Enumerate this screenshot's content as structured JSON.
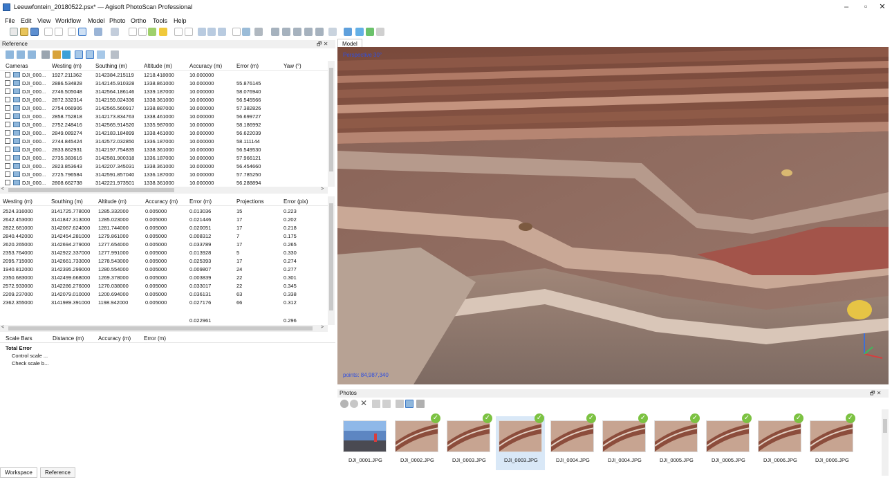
{
  "window": {
    "title": "Leeuwfontein_20180522.psx* — Agisoft PhotoScan Professional",
    "minimize": "–",
    "maximize": "▫",
    "close": "✕"
  },
  "menu": [
    "File",
    "Edit",
    "View",
    "Workflow",
    "Model",
    "Photo",
    "Ortho",
    "Tools",
    "Help"
  ],
  "reference_panel": {
    "title": "Reference",
    "controls": "🗗 ✕"
  },
  "model_tab": {
    "label": "Model"
  },
  "cameras_table": {
    "headers": [
      "Cameras",
      "Westing (m)",
      "Southing (m)",
      "Altitude (m)",
      "Accuracy (m)",
      "Error (m)",
      "Yaw (°)"
    ],
    "rows": [
      [
        "DJI_000...",
        "1927.211362",
        "3142384.215119",
        "1218.418000",
        "10.000000",
        ""
      ],
      [
        "DJI_000...",
        "2886.534828",
        "3142145.910328",
        "1338.861000",
        "10.000000",
        "55.876145"
      ],
      [
        "DJI_000...",
        "2746.505048",
        "3142564.186146",
        "1339.187000",
        "10.000000",
        "58.076940"
      ],
      [
        "DJI_000...",
        "2872.332314",
        "3142159.024336",
        "1338.361000",
        "10.000000",
        "56.545566"
      ],
      [
        "DJI_000...",
        "2754.066906",
        "3142565.560917",
        "1338.887000",
        "10.000000",
        "57.382826"
      ],
      [
        "DJI_000...",
        "2858.752818",
        "3142173.834763",
        "1338.461000",
        "10.000000",
        "56.699727"
      ],
      [
        "DJI_000...",
        "2752.248416",
        "3142565.914520",
        "1335.987000",
        "10.000000",
        "58.186992"
      ],
      [
        "DJI_000...",
        "2849.089274",
        "3142183.184899",
        "1338.461000",
        "10.000000",
        "56.622039"
      ],
      [
        "DJI_000...",
        "2744.845424",
        "3142572.032850",
        "1336.187000",
        "10.000000",
        "58.111144"
      ],
      [
        "DJI_000...",
        "2833.862931",
        "3142197.754835",
        "1338.361000",
        "10.000000",
        "56.549530"
      ],
      [
        "DJI_000...",
        "2735.383616",
        "3142581.900318",
        "1336.187000",
        "10.000000",
        "57.966121"
      ],
      [
        "DJI_000...",
        "2823.853643",
        "3142207.345031",
        "1338.361000",
        "10.000000",
        "56.454660"
      ],
      [
        "DJI_000...",
        "2725.796584",
        "3142591.857040",
        "1336.187000",
        "10.000000",
        "57.785250"
      ],
      [
        "DJI_000...",
        "2808.662738",
        "3142221.973501",
        "1338.361000",
        "10.000000",
        "56.288894"
      ]
    ]
  },
  "markers_table": {
    "headers": [
      "Westing (m)",
      "Southing (m)",
      "Altitude (m)",
      "Accuracy (m)",
      "Error (m)",
      "Projections",
      "Error (pix)"
    ],
    "rows": [
      [
        "2524.316000",
        "3141725.778000",
        "1285.332000",
        "0.005000",
        "0.013036",
        "15",
        "0.223"
      ],
      [
        "2642.453000",
        "3141847.313000",
        "1285.023000",
        "0.005000",
        "0.021446",
        "17",
        "0.202"
      ],
      [
        "2822.681000",
        "3142067.624000",
        "1281.744000",
        "0.005000",
        "0.020051",
        "17",
        "0.218"
      ],
      [
        "2840.442000",
        "3142454.281000",
        "1279.861000",
        "0.005000",
        "0.008312",
        "7",
        "0.175"
      ],
      [
        "2620.265000",
        "3142694.279000",
        "1277.654000",
        "0.005000",
        "0.033789",
        "17",
        "0.265"
      ],
      [
        "2353.764000",
        "3142922.337000",
        "1277.991000",
        "0.005000",
        "0.013928",
        "5",
        "0.330"
      ],
      [
        "2095.715000",
        "3142661.733000",
        "1278.543000",
        "0.005000",
        "0.025393",
        "17",
        "0.274"
      ],
      [
        "1940.812000",
        "3142395.299000",
        "1280.554000",
        "0.005000",
        "0.009807",
        "24",
        "0.277"
      ],
      [
        "2350.683000",
        "3142499.668000",
        "1269.378000",
        "0.005000",
        "0.003839",
        "22",
        "0.301"
      ],
      [
        "2572.933000",
        "3142286.276000",
        "1270.038000",
        "0.005000",
        "0.033017",
        "22",
        "0.345"
      ],
      [
        "2209.237000",
        "3142079.010000",
        "1200.694000",
        "0.005000",
        "0.036131",
        "63",
        "0.338"
      ],
      [
        "2362.355000",
        "3141989.391000",
        "1198.942000",
        "0.005000",
        "0.027176",
        "66",
        "0.312"
      ]
    ],
    "total_error": "0.022961",
    "total_error_pix": "0.296"
  },
  "scalebars_table": {
    "headers": [
      "Scale Bars",
      "Distance (m)",
      "Accuracy (m)",
      "Error (m)"
    ],
    "total_error": "Total Error",
    "control": "Control scale ...",
    "check": "Check scale b..."
  },
  "bottom_tabs": [
    "Workspace",
    "Reference"
  ],
  "viewport": {
    "perspective": "Perspective 30°",
    "points": "points: 84,987,340"
  },
  "photos_panel": {
    "title": "Photos",
    "controls": "🗗 ✕",
    "thumbnails": [
      {
        "label": "DJI_0001.JPG",
        "checked": false,
        "selected": false
      },
      {
        "label": "DJI_0002.JPG",
        "checked": true,
        "selected": false
      },
      {
        "label": "DJI_0003.JPG",
        "checked": true,
        "selected": false
      },
      {
        "label": "DJI_0003.JPG",
        "checked": true,
        "selected": true
      },
      {
        "label": "DJI_0004.JPG",
        "checked": true,
        "selected": false
      },
      {
        "label": "DJI_0004.JPG",
        "checked": true,
        "selected": false
      },
      {
        "label": "DJI_0005.JPG",
        "checked": true,
        "selected": false
      },
      {
        "label": "DJI_0005.JPG",
        "checked": true,
        "selected": false
      },
      {
        "label": "DJI_0006.JPG",
        "checked": true,
        "selected": false
      },
      {
        "label": "DJI_0006.JPG",
        "checked": true,
        "selected": false
      }
    ]
  },
  "colors": {
    "accent": "#3a78c8",
    "check_green": "#7cc242",
    "selection": "#d9e8f7"
  }
}
